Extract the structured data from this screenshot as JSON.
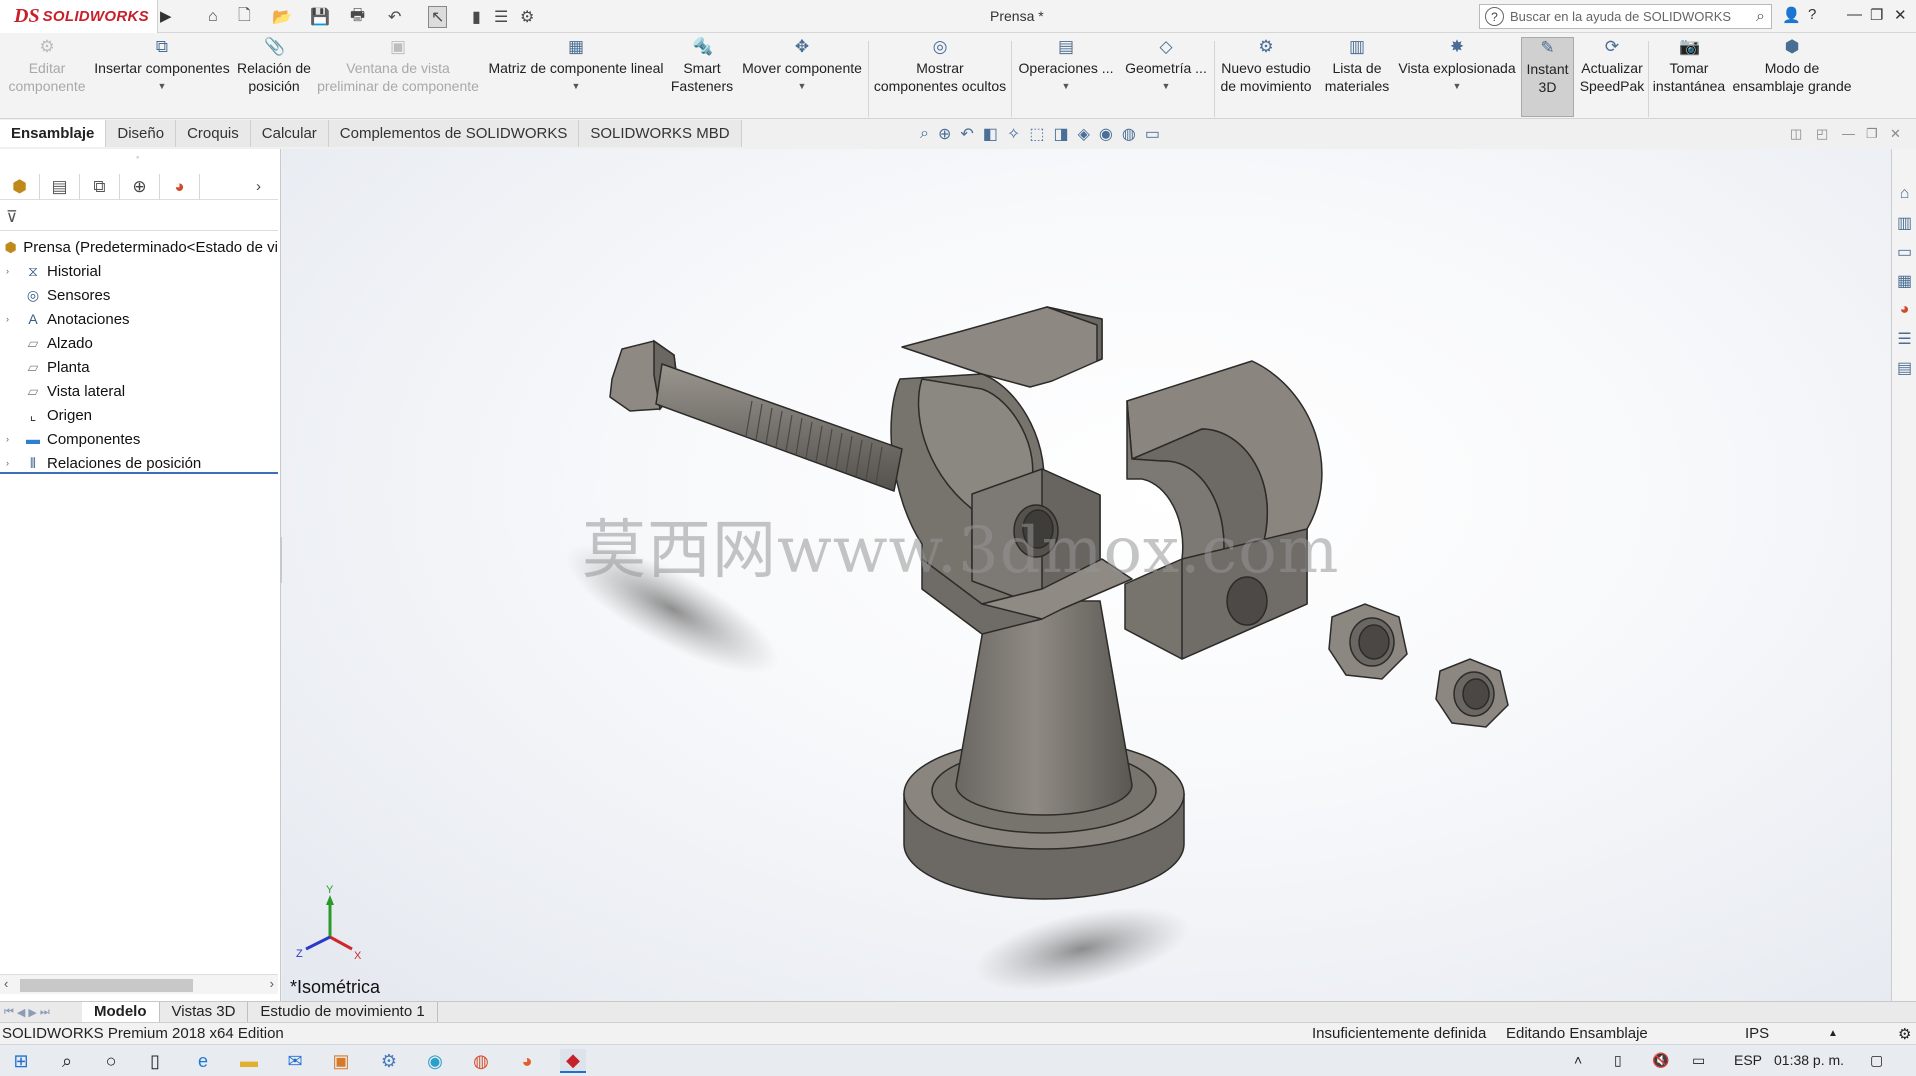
{
  "app": {
    "brand_ds": "DS",
    "brand_name": "SOLIDWORKS",
    "document_title": "Prensa *",
    "search_placeholder": "Buscar en la ayuda de SOLIDWORKS"
  },
  "commands": [
    {
      "label": "Editar\ncomponente",
      "icon": "edit-component-icon",
      "enabled": false
    },
    {
      "label": "Insertar componentes",
      "icon": "insert-components-icon",
      "enabled": true
    },
    {
      "label": "Relación de\nposición",
      "icon": "mate-icon",
      "enabled": true
    },
    {
      "label": "Ventana de vista\npreliminar de componente",
      "icon": "preview-window-icon",
      "enabled": false
    },
    {
      "label": "Matriz de componente lineal",
      "icon": "linear-pattern-icon",
      "enabled": true
    },
    {
      "label": "Smart\nFasteners",
      "icon": "fasteners-icon",
      "enabled": true
    },
    {
      "label": "Mover componente",
      "icon": "move-component-icon",
      "enabled": true
    },
    {
      "label": "Mostrar\ncomponentes ocultos",
      "icon": "show-hidden-icon",
      "enabled": true
    },
    {
      "label": "Operaciones ...",
      "icon": "features-icon",
      "enabled": true
    },
    {
      "label": "Geometría ...",
      "icon": "reference-geometry-icon",
      "enabled": true
    },
    {
      "label": "Nuevo estudio\nde movimiento",
      "icon": "motion-study-icon",
      "enabled": true
    },
    {
      "label": "Lista de\nmateriales",
      "icon": "bom-icon",
      "enabled": true
    },
    {
      "label": "Vista explosionada",
      "icon": "exploded-view-icon",
      "enabled": true
    },
    {
      "label": "Instant\n3D",
      "icon": "instant3d-icon",
      "enabled": true
    },
    {
      "label": "Actualizar\nSpeedPak",
      "icon": "speedpak-icon",
      "enabled": true
    },
    {
      "label": "Tomar\ninstantánea",
      "icon": "snapshot-icon",
      "enabled": true
    },
    {
      "label": "Modo de\nensamblaje grande",
      "icon": "large-assembly-icon",
      "enabled": true
    }
  ],
  "tabs": [
    "Ensamblaje",
    "Diseño",
    "Croquis",
    "Calcular",
    "Complementos de SOLIDWORKS",
    "SOLIDWORKS MBD"
  ],
  "tree": {
    "root": "Prensa  (Predeterminado<Estado de vi",
    "items": [
      {
        "label": "Historial",
        "expandable": true,
        "icon": "history-icon"
      },
      {
        "label": "Sensores",
        "expandable": false,
        "icon": "sensors-icon"
      },
      {
        "label": "Anotaciones",
        "expandable": true,
        "icon": "annotations-icon"
      },
      {
        "label": "Alzado",
        "expandable": false,
        "icon": "plane-icon"
      },
      {
        "label": "Planta",
        "expandable": false,
        "icon": "plane-icon"
      },
      {
        "label": "Vista lateral",
        "expandable": false,
        "icon": "plane-icon"
      },
      {
        "label": "Origen",
        "expandable": false,
        "icon": "origin-icon"
      },
      {
        "label": "Componentes",
        "expandable": true,
        "icon": "folder-icon"
      },
      {
        "label": "Relaciones de posición",
        "expandable": true,
        "icon": "mates-icon"
      }
    ]
  },
  "viewport": {
    "view_name": "*Isométrica",
    "watermark": "莫西网www.3dmox.com",
    "triad_labels": {
      "x": "X",
      "y": "Y",
      "z": "Z"
    }
  },
  "bottom_tabs": [
    "Modelo",
    "Vistas 3D",
    "Estudio de movimiento 1"
  ],
  "status": {
    "edition": "SOLIDWORKS Premium 2018 x64 Edition",
    "definition": "Insuficientemente definida",
    "mode": "Editando Ensamblaje",
    "units": "IPS"
  },
  "taskbar": {
    "language": "ESP",
    "time": "01:38 p. m."
  },
  "colors": {
    "brand": "#c8202b",
    "model": "#7a7672",
    "accent": "#3b6fb8"
  }
}
